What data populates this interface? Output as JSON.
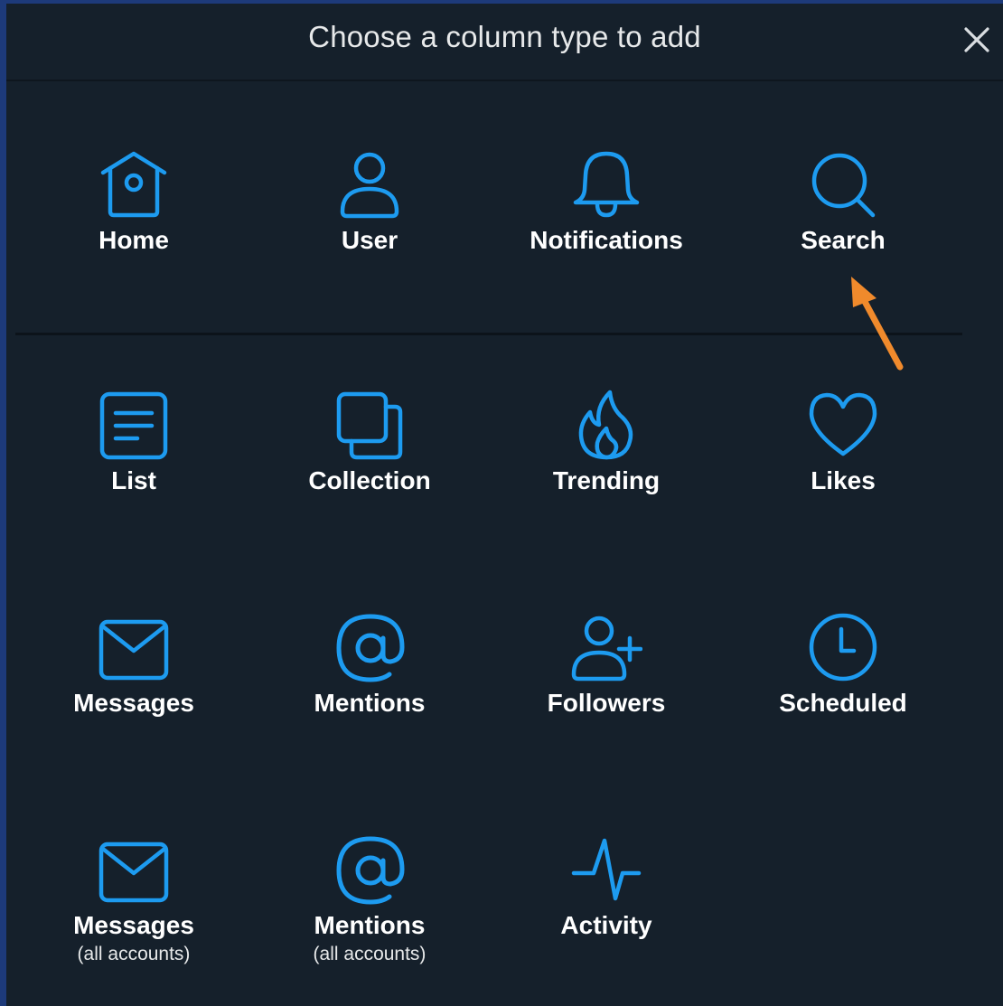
{
  "dialog": {
    "title": "Choose a column type to add",
    "close_label": "close"
  },
  "colors": {
    "accent": "#1d9bf0",
    "background": "#15202b",
    "frame": "#1d3a7a",
    "annotation": "#f08a2c"
  },
  "columns": {
    "home": {
      "label": "Home",
      "icon": "home-icon"
    },
    "user": {
      "label": "User",
      "icon": "user-icon"
    },
    "notifications": {
      "label": "Notifications",
      "icon": "bell-icon"
    },
    "search": {
      "label": "Search",
      "icon": "search-icon"
    },
    "list": {
      "label": "List",
      "icon": "list-icon"
    },
    "collection": {
      "label": "Collection",
      "icon": "collection-icon"
    },
    "trending": {
      "label": "Trending",
      "icon": "flame-icon"
    },
    "likes": {
      "label": "Likes",
      "icon": "heart-icon"
    },
    "messages": {
      "label": "Messages",
      "icon": "envelope-icon"
    },
    "mentions": {
      "label": "Mentions",
      "icon": "at-icon"
    },
    "followers": {
      "label": "Followers",
      "icon": "user-plus-icon"
    },
    "scheduled": {
      "label": "Scheduled",
      "icon": "clock-icon"
    },
    "messages_all": {
      "label": "Messages",
      "sublabel": "(all accounts)",
      "icon": "envelope-icon"
    },
    "mentions_all": {
      "label": "Mentions",
      "sublabel": "(all accounts)",
      "icon": "at-icon"
    },
    "activity": {
      "label": "Activity",
      "icon": "activity-icon"
    }
  }
}
